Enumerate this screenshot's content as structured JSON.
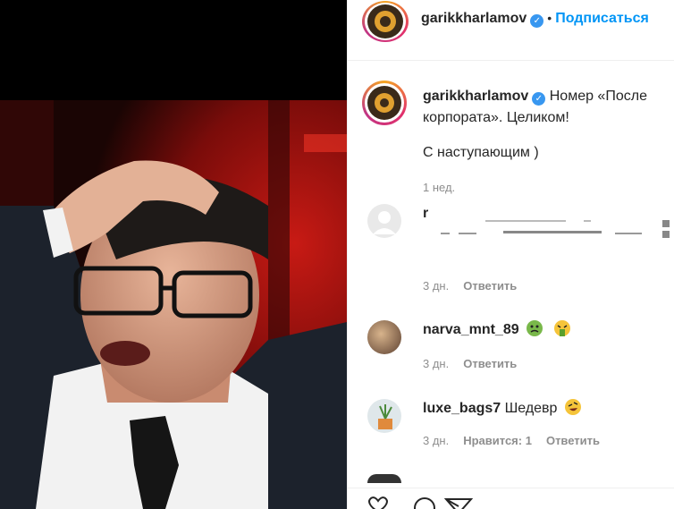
{
  "header": {
    "username": "garikkharlamov",
    "separator": "•",
    "follow_label": "Подписаться"
  },
  "caption": {
    "username": "garikkharlamov",
    "text": "Номер «После корпората». Целиком!",
    "extra": "С наступающим )",
    "time": "1 нед."
  },
  "comments": [
    {
      "username": "r",
      "text": "",
      "time": "3 дн.",
      "reply_label": "Ответить"
    },
    {
      "username": "narva_mnt_89",
      "text": "",
      "time": "3 дн.",
      "reply_label": "Ответить"
    },
    {
      "username": "luxe_bags7",
      "text": "Шедевр",
      "time": "3 дн.",
      "likes_label": "Нравится: 1",
      "reply_label": "Ответить"
    }
  ],
  "icons": {
    "verified": "verified-badge-icon",
    "like": "heart-icon",
    "comment": "comment-icon",
    "share": "share-icon",
    "emoji_nauseated": "nauseated-face-icon",
    "emoji_vomiting": "vomiting-face-icon",
    "emoji_rofl": "rolling-laughing-face-icon"
  },
  "colors": {
    "link_blue": "#0095f6",
    "verified_blue": "#3897f0",
    "muted_text": "#8e8e8e"
  }
}
